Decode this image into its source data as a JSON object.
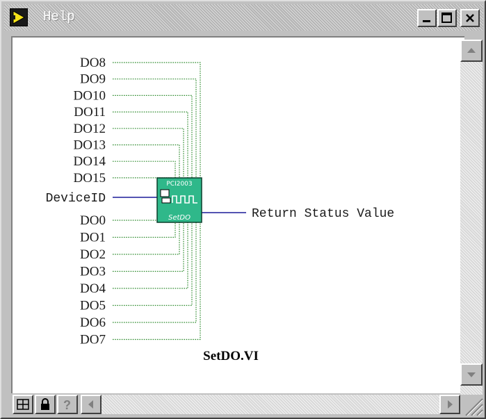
{
  "window": {
    "title": "Help"
  },
  "vi": {
    "icon_top_label": "PCI2003",
    "icon_bottom_label": "SetDO",
    "name": "SetDO.VI"
  },
  "terminals": {
    "upper": [
      "DO8",
      "DO9",
      "DO10",
      "DO11",
      "DO12",
      "DO13",
      "DO14",
      "DO15"
    ],
    "device_id": "DeviceID",
    "lower": [
      "DO0",
      "DO1",
      "DO2",
      "DO3",
      "DO4",
      "DO5",
      "DO6",
      "DO7"
    ],
    "output": "Return Status Value"
  },
  "colors": {
    "bool_wire": "#2e8b2e",
    "numeric_wire": "#1a1a99",
    "vi_icon_fill": "#2fb88a"
  },
  "icons": {
    "app": "labview-run-arrow-icon",
    "toolbar": [
      "block-diagram-icon",
      "lock-icon",
      "help-question-icon"
    ]
  }
}
